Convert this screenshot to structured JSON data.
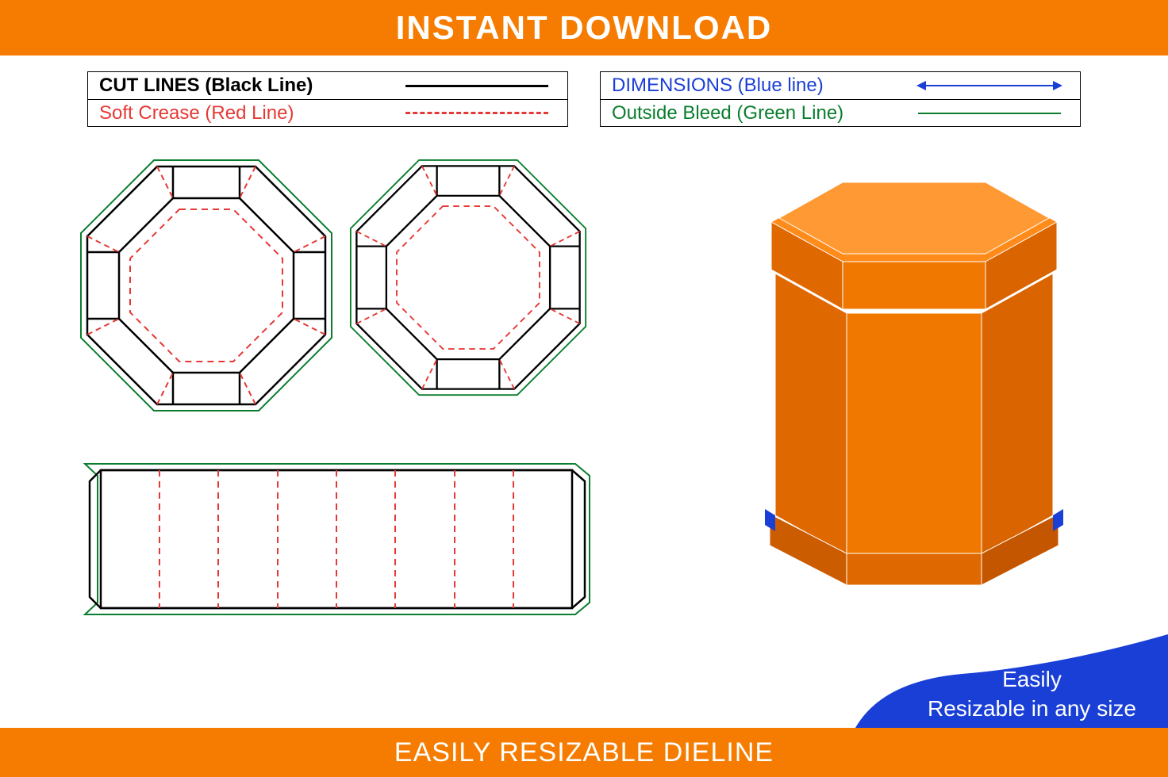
{
  "header": {
    "title": "INSTANT DOWNLOAD"
  },
  "footer": {
    "title": "EASILY RESIZABLE DIELINE"
  },
  "legend": {
    "cut": "CUT LINES (Black Line)",
    "crease": "Soft Crease (Red Line)",
    "dimensions": "DIMENSIONS (Blue line)",
    "bleed": "Outside Bleed (Green Line)"
  },
  "badge": {
    "line1": "Easily",
    "line2": "Resizable in any size"
  },
  "colors": {
    "orange": "#f57c00",
    "blue": "#1a3fd6",
    "green": "#0a7d2e",
    "red": "#e53935",
    "box_orange_light": "#ff8c1a",
    "box_orange_dark": "#d96400"
  },
  "diagram": {
    "type": "packaging-dieline",
    "components": [
      "octagon-top",
      "octagon-base",
      "body-strip"
    ],
    "product": "octagonal-box"
  }
}
